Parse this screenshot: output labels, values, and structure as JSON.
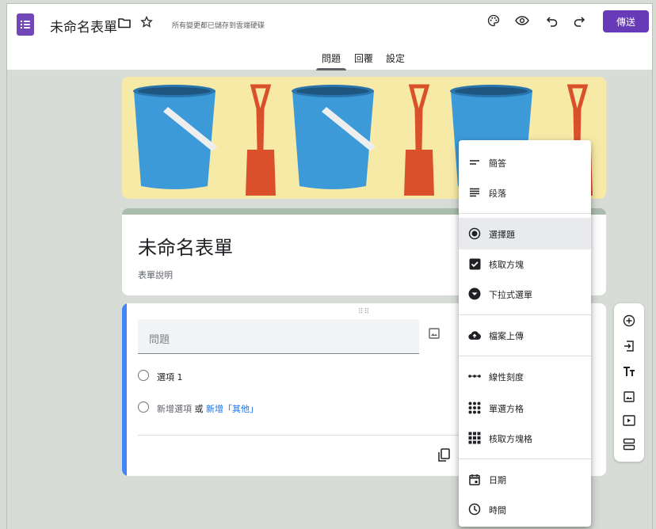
{
  "header": {
    "title": "未命名表單",
    "saved_status": "所有變更都已儲存到雲端硬碟",
    "send_label": "傳送",
    "icons": [
      "forms-app-icon",
      "folder-icon",
      "star-icon",
      "palette-icon",
      "preview-eye-icon",
      "undo-icon",
      "redo-icon"
    ]
  },
  "tabs": [
    {
      "label": "問題",
      "active": true
    },
    {
      "label": "回覆",
      "active": false
    },
    {
      "label": "設定",
      "active": false
    }
  ],
  "form": {
    "title": "未命名表單",
    "description": "表單說明"
  },
  "question": {
    "placeholder": "問題",
    "option1": "選項 1",
    "add_option": "新增選項",
    "or_text": "或",
    "add_other": "新增「其他」"
  },
  "menu": {
    "items": [
      {
        "label": "簡答",
        "icon": "short-answer-icon"
      },
      {
        "label": "段落",
        "icon": "paragraph-icon"
      },
      {
        "label": "選擇題",
        "icon": "radio-icon",
        "selected": true
      },
      {
        "label": "核取方塊",
        "icon": "checkbox-icon"
      },
      {
        "label": "下拉式選單",
        "icon": "dropdown-icon"
      },
      {
        "label": "檔案上傳",
        "icon": "cloud-upload-icon"
      },
      {
        "label": "線性刻度",
        "icon": "linear-scale-icon"
      },
      {
        "label": "單選方格",
        "icon": "grid-dots-icon"
      },
      {
        "label": "核取方塊格",
        "icon": "grid-squares-icon"
      },
      {
        "label": "日期",
        "icon": "calendar-icon"
      },
      {
        "label": "時間",
        "icon": "clock-icon"
      }
    ]
  },
  "toolbar": {
    "icons": [
      "add-question-icon",
      "import-question-icon",
      "add-title-icon",
      "add-image-icon",
      "add-video-icon",
      "add-section-icon"
    ]
  },
  "colors": {
    "brand": "#673ab7",
    "link": "#1a73e8",
    "question_accent": "#4285f4",
    "banner_bg": "#f7eaa6",
    "bucket": "#3d9ad9",
    "shovel": "#d9502a"
  }
}
